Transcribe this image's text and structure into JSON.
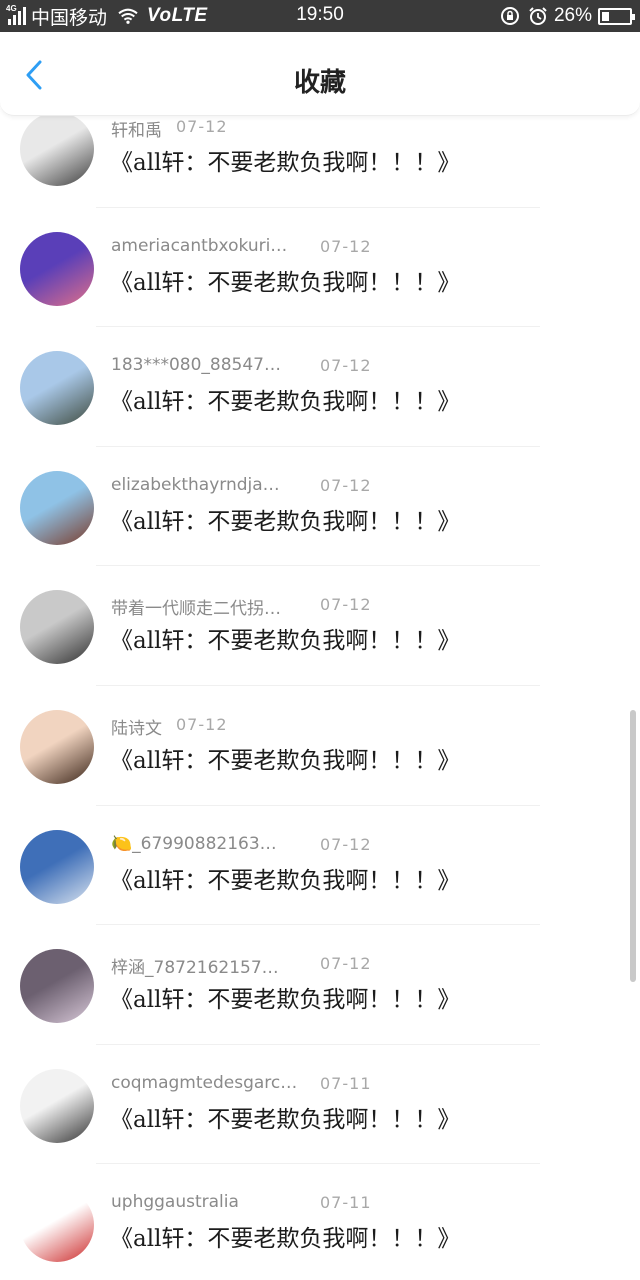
{
  "status_bar": {
    "network": "4G",
    "carrier": "中国移动",
    "volte": "VoLTE",
    "time": "19:50",
    "battery_percent": "26%",
    "battery_level": 0.26
  },
  "header": {
    "title": "收藏"
  },
  "items": [
    {
      "name": "轩和禹",
      "date": "07-12",
      "content": "《all轩：不要老欺负我啊！！！》",
      "avatar_colors": [
        "#e8e8e8",
        "#3d3d3d"
      ]
    },
    {
      "name": "ameriacantbxokuri…",
      "date": "07-12",
      "content": "《all轩：不要老欺负我啊！！！》",
      "avatar_colors": [
        "#5a3fb8",
        "#e0708a"
      ]
    },
    {
      "name": "183***080_88547…",
      "date": "07-12",
      "content": "《all轩：不要老欺负我啊！！！》",
      "avatar_colors": [
        "#a9c8e8",
        "#3e4a3e"
      ]
    },
    {
      "name": "elizabekthayrndja…",
      "date": "07-12",
      "content": "《all轩：不要老欺负我啊！！！》",
      "avatar_colors": [
        "#8fc2e6",
        "#7a3b2a"
      ]
    },
    {
      "name": "带着一代顺走二代拐…",
      "date": "07-12",
      "content": "《all轩：不要老欺负我啊！！！》",
      "avatar_colors": [
        "#c9c9c9",
        "#2f2f2f"
      ]
    },
    {
      "name": "陆诗文",
      "date": "07-12",
      "content": "《all轩：不要老欺负我啊！！！》",
      "avatar_colors": [
        "#f1d4c0",
        "#3a2418"
      ]
    },
    {
      "name": "🍋_67990882163…",
      "date": "07-12",
      "content": "《all轩：不要老欺负我啊！！！》",
      "avatar_colors": [
        "#3f6fb8",
        "#d9e3ef"
      ]
    },
    {
      "name": "梓涵_7872162157…",
      "date": "07-12",
      "content": "《all轩：不要老欺负我啊！！！》",
      "avatar_colors": [
        "#6c6070",
        "#d8c8d8"
      ]
    },
    {
      "name": "coqmagmtedesgarc…",
      "date": "07-11",
      "content": "《all轩：不要老欺负我啊！！！》",
      "avatar_colors": [
        "#f2f2f2",
        "#333333"
      ]
    },
    {
      "name": "uphggaustralia",
      "date": "07-11",
      "content": "《all轩：不要老欺负我啊！！！》",
      "avatar_colors": [
        "#ffffff",
        "#cc2a2a"
      ]
    }
  ]
}
